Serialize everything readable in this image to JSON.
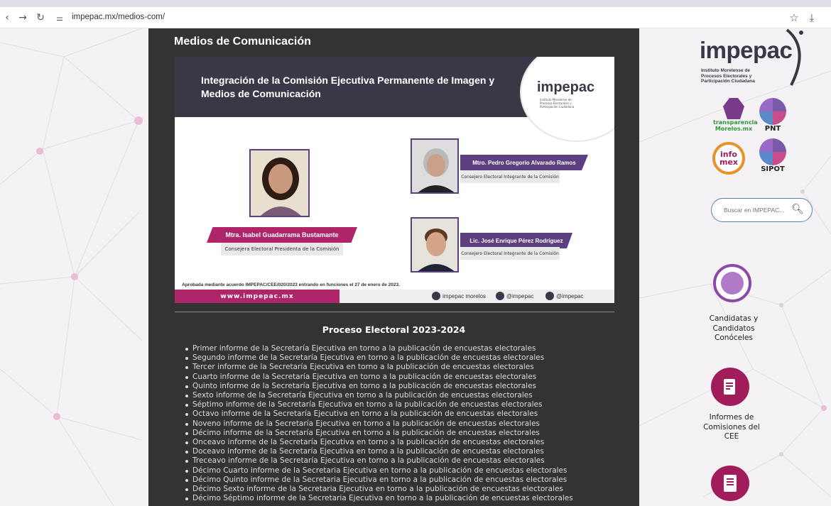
{
  "browser": {
    "url": "impepac.mx/medios-com/"
  },
  "main": {
    "heading": "Medios de Comunicación",
    "banner": {
      "title": "Integración de la Comisión Ejecutiva Permanente de Imagen y Medios de Comunicación",
      "logo_text": "impepac",
      "logo_sub": "Instituto Morelense de Procesos Electorales y Participación Ciudadana",
      "members": [
        {
          "name": "Mtra. Isabel Guadarrama Bustamante",
          "role": "Consejera Electoral Presidenta de la Comisión"
        },
        {
          "name": "Mtro. Pedro Gregorio Alvarado Ramos",
          "role": "Consejero Electoral Integrante de la Comisión"
        },
        {
          "name": "Lic. José Enrique Pérez Rodríguez",
          "role": "Consejero Electoral Integrante de la Comisión"
        }
      ],
      "note": "Aprobada mediante acuerdo IMPEPAC/CEE/020/2023 entrando en funciones el 27 de enero de 2023.",
      "website": "www.impepac.mx",
      "social": [
        {
          "label": "impepac morelos",
          "icon": "youtube-icon"
        },
        {
          "label": "@impepac",
          "icon": "facebook-icon"
        },
        {
          "label": "@impepac",
          "icon": "twitter-icon"
        }
      ]
    },
    "section_title": "Proceso Electoral 2023-2024",
    "reports": [
      "Primer informe de la Secretaría Ejecutiva en torno a la publicación de encuestas electorales",
      "Segundo informe de la Secretaría Ejecutiva en torno a la publicación de encuestas electorales",
      "Tercer informe de la Secretaría Ejecutiva en torno a la publicación de encuestas electorales",
      "Cuarto informe de la Secretaría Ejecutiva en torno a la publicación de encuestas electorales",
      "Quinto informe de la Secretaría Ejecutiva en torno a la publicación de encuestas electorales",
      "Sexto informe de la Secretaría Ejecutiva en torno a la publicación de encuestas electorales",
      "Séptimo informe de la Secretaría Ejecutiva en torno a la publicación de encuestas electorales",
      "Octavo informe de la Secretaría Ejecutiva en torno a la publicación de encuestas electorales",
      "Noveno informe de la Secretaría Ejecutiva en torno a la publicación de encuestas electorales",
      "Décimo informe de la Secretaría Ejecutiva en torno a la publicación de encuestas electorales",
      "Onceavo informe de la Secretaría Ejecutiva en torno a la publicación de encuestas electorales",
      "Doceavo informe de la Secretaría Ejecutiva en torno a la publicación de encuestas electorales",
      "Treceavo informe de la Secretaría Ejecutiva en torno a la publicación de encuestas electorales",
      "Décimo Cuarto informe de la Secretaria Ejecutiva en torno a la publicación de encuestas electorales",
      "Décimo Quinto informe de la Secretaria Ejecutiva en torno a la publicación de encuestas electorales",
      "Décimo Sexto informe de la Secretaria Ejecutiva en torno a la publicación de encuestas electorales",
      "Décimo Séptimo informe de la Secretaria Ejecutiva en torno a la publicación de encuestas electorales"
    ]
  },
  "sidebar": {
    "logo_text": "impepac",
    "logo_sub": "Instituto Morelense de Procesos Electorales y Participación Ciudadana",
    "badges": [
      {
        "label": "transparencia Morelos.mx",
        "icon": "transparencia-icon"
      },
      {
        "label": "PNT",
        "icon": "pnt-icon"
      },
      {
        "label": "info mex",
        "icon": "infomex-icon"
      },
      {
        "label": "SIPOT",
        "icon": "sipot-icon"
      }
    ],
    "search_placeholder": "Buscar en IMPEPAC...",
    "links": [
      {
        "label": "Candidatas y Candidatos Conóceles",
        "icon": "candidates-icon"
      },
      {
        "label": "Informes de Comisiones del CEE",
        "icon": "report-edit-icon"
      },
      {
        "label": "",
        "icon": "document-icon"
      }
    ]
  },
  "colors": {
    "panel": "#333333",
    "banner_dark": "#3a3847",
    "magenta": "#b0246a",
    "purple": "#5b3f7f",
    "background": "#f4f2f4"
  }
}
